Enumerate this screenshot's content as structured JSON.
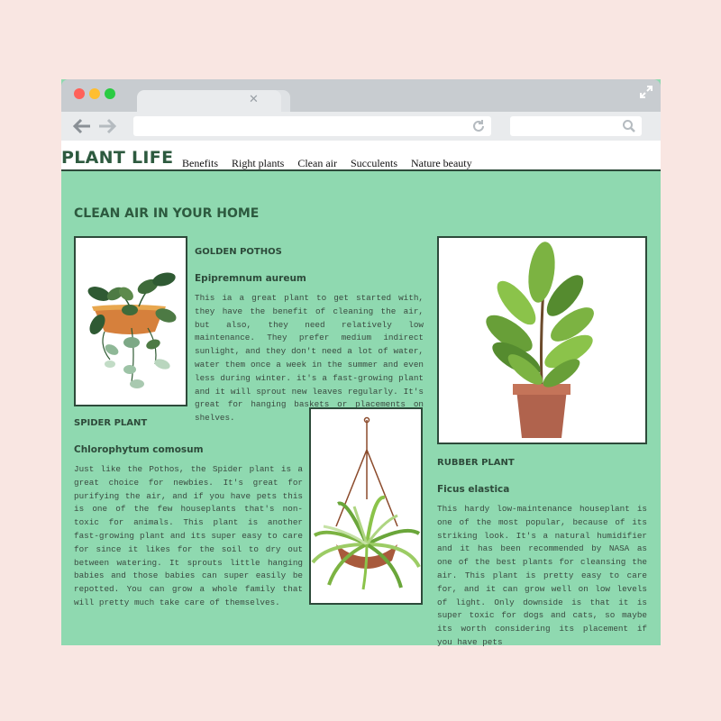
{
  "site": {
    "logo": "PLANT LIFE",
    "nav": [
      "Benefits",
      "Right plants",
      "Clean air",
      "Succulents",
      "Nature beauty"
    ]
  },
  "colors": {
    "page_background": "#f9e6e2",
    "content_background": "#8fd9b0",
    "heading": "#2d5a3f",
    "frame_border": "#2d4a3a"
  },
  "section_title": "CLEAN AIR IN YOUR HOME",
  "plants": [
    {
      "name": "GOLDEN POTHOS",
      "latin": "Epipremnum aureum",
      "description": "This ia a great plant to get started with, they have the benefit of cleaning the air, but also, they need relatively low maintenance. They prefer medium indirect sunlight, and they don't need a lot of water, water them once a week in the summer and even less during winter. it's a fast-growing plant and it will sprout new leaves regularly. It's great for hanging baskets or placements on shelves.",
      "image_icon": "pothos-plant-icon"
    },
    {
      "name": "SPIDER PLANT",
      "latin": "Chlorophytum comosum",
      "description": "Just like the Pothos, the Spider plant is a great choice for newbies. It's great for purifying the air, and if you have pets this is one of the few houseplants that's non-toxic for animals. This plant is another fast-growing plant and its super easy to care for since it likes for the soil to dry out between watering. It sprouts little hanging babies and those babies can super easily be repotted. You can grow a whole family that will pretty much take care of themselves.",
      "image_icon": "spider-plant-icon"
    },
    {
      "name": "RUBBER PLANT",
      "latin": "Ficus elastica",
      "description": "This hardy low-maintenance houseplant is one of the most popular, because of its striking look. It's a natural humidifier and it has been recommended by NASA as one of the best plants for cleansing the air. This plant is pretty easy to care for, and it can grow well on low levels of light. Only downside is that it is super toxic for dogs and cats, so maybe its worth considering its placement if you have pets",
      "image_icon": "rubber-plant-icon"
    }
  ]
}
